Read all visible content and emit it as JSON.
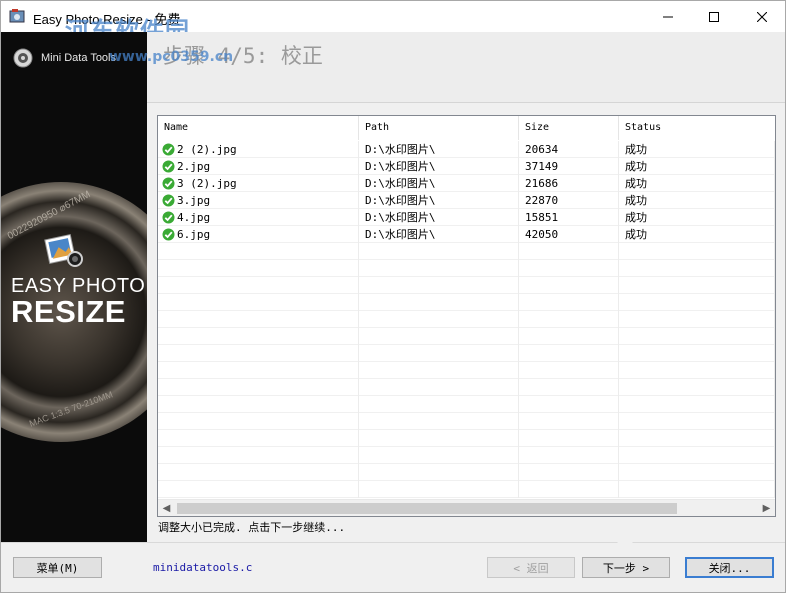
{
  "window": {
    "title": "Easy Photo Resize - 免费",
    "watermark": "河东软件园",
    "watermark_url": "www.pc0359.cn",
    "controls": {
      "minimize": "—",
      "maximize": "☐",
      "close": "✕"
    }
  },
  "sidebar": {
    "brand": "Mini Data Tools",
    "lens_text_top": "0022920950 ⌀67MM",
    "lens_text_bottom": "MAC 1:3.5 70-210MM",
    "product_line1": "EASY PHOTO",
    "product_line2": "RESIZE"
  },
  "header": {
    "step_title": "步骤 4/5: 校正"
  },
  "table": {
    "columns": [
      "Name",
      "Path",
      "Size",
      "Status"
    ],
    "rows": [
      {
        "name": "2 (2).jpg",
        "path": "D:\\水印图片\\",
        "size": "20634",
        "status": "成功"
      },
      {
        "name": "2.jpg",
        "path": "D:\\水印图片\\",
        "size": "37149",
        "status": "成功"
      },
      {
        "name": "3 (2).jpg",
        "path": "D:\\水印图片\\",
        "size": "21686",
        "status": "成功"
      },
      {
        "name": "3.jpg",
        "path": "D:\\水印图片\\",
        "size": "22870",
        "status": "成功"
      },
      {
        "name": "4.jpg",
        "path": "D:\\水印图片\\",
        "size": "15851",
        "status": "成功"
      },
      {
        "name": "6.jpg",
        "path": "D:\\水印图片\\",
        "size": "42050",
        "status": "成功"
      }
    ],
    "empty_rows": 15,
    "scroll_left": "◀",
    "scroll_right": "▶"
  },
  "status_text": "调整大小已完成. 点击下一步继续...",
  "footer": {
    "menu_label": "菜单(M)",
    "link": "minidatatools.c",
    "back_label": "< 返回",
    "next_label": "下一步 >",
    "close_label": "关闭..."
  },
  "colors": {
    "success_green": "#3aaa35",
    "accent_blue": "#3a7dd1",
    "link_blue": "#1a1aa6"
  }
}
